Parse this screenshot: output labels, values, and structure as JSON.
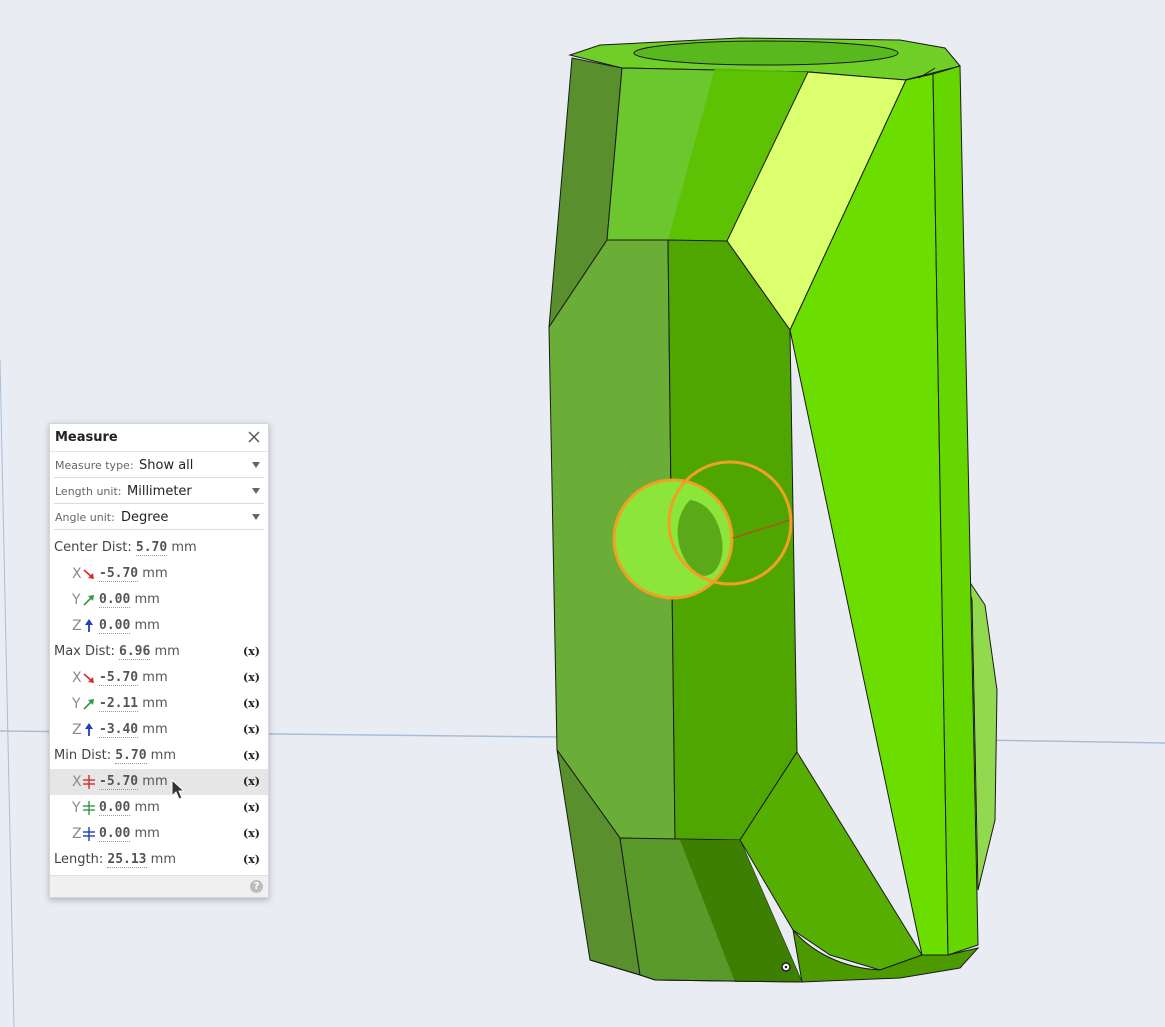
{
  "panel": {
    "title": "Measure",
    "measure_type_label": "Measure type:",
    "measure_type_value": "Show all",
    "length_unit_label": "Length unit:",
    "length_unit_value": "Millimeter",
    "angle_unit_label": "Angle unit:",
    "angle_unit_value": "Degree",
    "help_glyph": "?"
  },
  "center": {
    "label": "Center Dist:",
    "value": "5.70",
    "unit": "mm",
    "x": "-5.70",
    "y": "0.00",
    "z": "0.00"
  },
  "max": {
    "label": "Max Dist:",
    "value": "6.96",
    "unit": "mm",
    "x": "-5.70",
    "y": "-2.11",
    "z": "-3.40"
  },
  "min": {
    "label": "Min Dist:",
    "value": "5.70",
    "unit": "mm",
    "x": "-5.70",
    "y": "0.00",
    "z": "0.00"
  },
  "length": {
    "label": "Length:",
    "value": "25.13",
    "unit": "mm"
  },
  "axes": {
    "x": "X",
    "y": "Y",
    "z": "Z"
  },
  "fx_glyph": "(x)",
  "colors": {
    "background": "#e9edf3",
    "axis_x": "#d32f2f",
    "axis_y": "#2e9b3e",
    "axis_z": "#1f3fbf",
    "highlight_circle": "#f2a023",
    "part_light": "#6bde00",
    "part_selected": "#dcff6e"
  }
}
